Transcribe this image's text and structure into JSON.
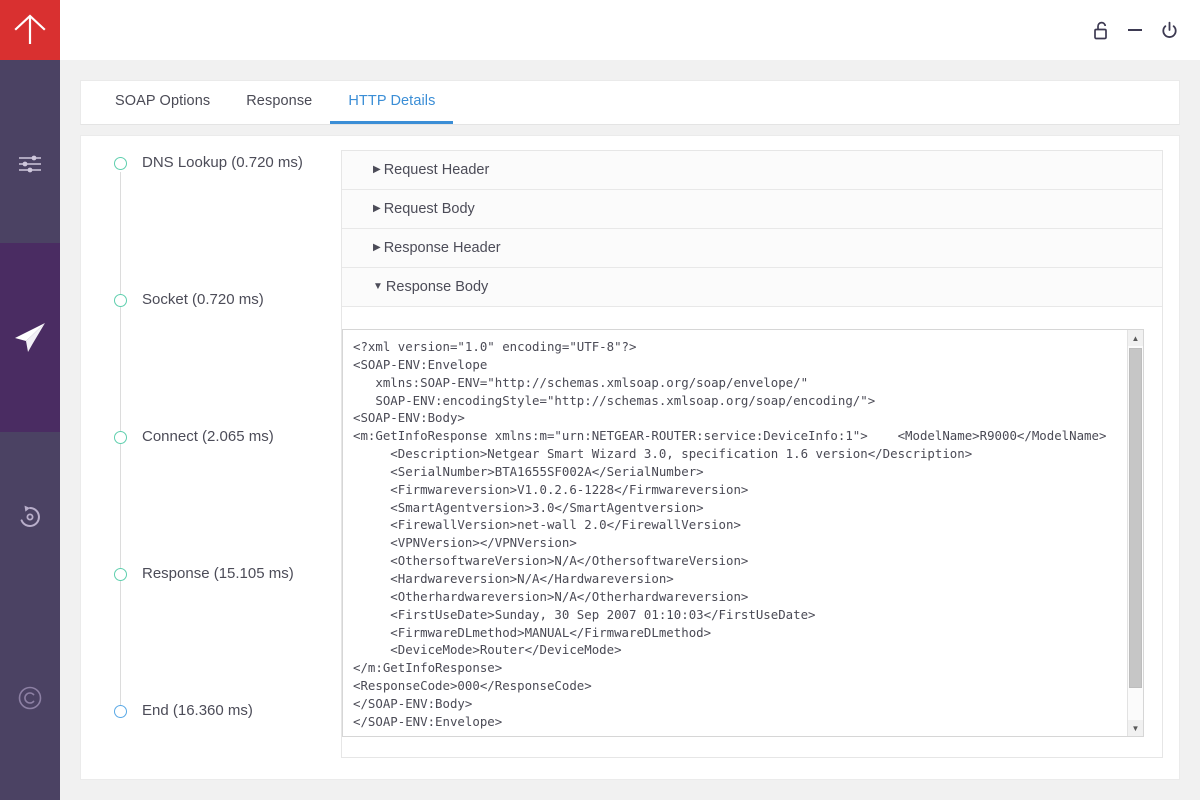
{
  "brand": {
    "logo_icon": "up-arrow-icon",
    "logo_color": "#d93030",
    "sidebar_color": "#4b4263",
    "sidebar_active_color": "#4a2c62"
  },
  "sidebar": {
    "items": [
      {
        "name": "settings-sliders",
        "icon": "sliders-icon",
        "active": false
      },
      {
        "name": "send-request",
        "icon": "paper-plane-icon",
        "active": true
      },
      {
        "name": "history",
        "icon": "history-icon",
        "active": false
      },
      {
        "name": "copyright",
        "icon": "copyright-icon",
        "active": false
      }
    ]
  },
  "titlebar": {
    "buttons": [
      {
        "name": "unlock",
        "icon": "unlock-icon"
      },
      {
        "name": "minimize",
        "icon": "minimize-icon"
      },
      {
        "name": "power",
        "icon": "power-icon"
      }
    ]
  },
  "tabs": {
    "active_color": "#3b8ed6",
    "items": [
      {
        "label": "SOAP Options",
        "active": false
      },
      {
        "label": "Response",
        "active": false
      },
      {
        "label": "HTTP Details",
        "active": true
      }
    ]
  },
  "timeline": {
    "dot_color": "#5fcfae",
    "end_dot_color": "#5aa9e6",
    "steps": [
      {
        "label": "DNS Lookup (0.720 ms)",
        "state": "done"
      },
      {
        "label": "Socket (0.720 ms)",
        "state": "done"
      },
      {
        "label": "Connect (2.065 ms)",
        "state": "done"
      },
      {
        "label": "Response (15.105 ms)",
        "state": "done"
      },
      {
        "label": "End (16.360 ms)",
        "state": "end"
      }
    ]
  },
  "accordion": {
    "sections": [
      {
        "label": "Request Header",
        "expanded": false,
        "caret": "▶"
      },
      {
        "label": "Request Body",
        "expanded": false,
        "caret": "▶"
      },
      {
        "label": "Response Header",
        "expanded": false,
        "caret": "▶"
      },
      {
        "label": "Response Body",
        "expanded": true,
        "caret": "▼"
      }
    ]
  },
  "response_body": {
    "xml": "<?xml version=\"1.0\" encoding=\"UTF-8\"?>\n<SOAP-ENV:Envelope\n   xmlns:SOAP-ENV=\"http://schemas.xmlsoap.org/soap/envelope/\"\n   SOAP-ENV:encodingStyle=\"http://schemas.xmlsoap.org/soap/encoding/\">\n<SOAP-ENV:Body>\n<m:GetInfoResponse xmlns:m=\"urn:NETGEAR-ROUTER:service:DeviceInfo:1\">    <ModelName>R9000</ModelName>\n     <Description>Netgear Smart Wizard 3.0, specification 1.6 version</Description>\n     <SerialNumber>BTA1655SF002A</SerialNumber>\n     <Firmwareversion>V1.0.2.6-1228</Firmwareversion>\n     <SmartAgentversion>3.0</SmartAgentversion>\n     <FirewallVersion>net-wall 2.0</FirewallVersion>\n     <VPNVersion></VPNVersion>\n     <OthersoftwareVersion>N/A</OthersoftwareVersion>\n     <Hardwareversion>N/A</Hardwareversion>\n     <Otherhardwareversion>N/A</Otherhardwareversion>\n     <FirstUseDate>Sunday, 30 Sep 2007 01:10:03</FirstUseDate>\n     <FirmwareDLmethod>MANUAL</FirmwareDLmethod>\n     <DeviceMode>Router</DeviceMode>\n</m:GetInfoResponse>\n<ResponseCode>000</ResponseCode>\n</SOAP-ENV:Body>\n</SOAP-ENV:Envelope>",
    "scrollbar": {
      "up_glyph": "▲",
      "down_glyph": "▼"
    }
  }
}
